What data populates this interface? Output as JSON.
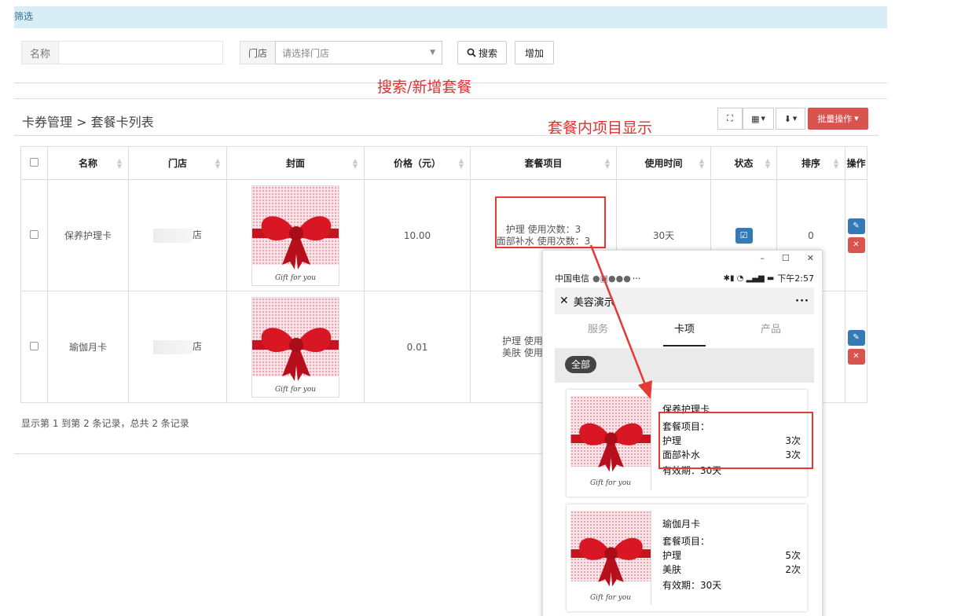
{
  "filter": {
    "title": "筛选"
  },
  "search": {
    "name_label": "名称",
    "name_value": "",
    "store_label": "门店",
    "store_placeholder": "请选择门店",
    "search_label": "搜索",
    "add_label": "增加"
  },
  "annotations": {
    "search_add": "搜索/新增套餐",
    "items_display": "套餐内项目显示"
  },
  "breadcrumb": "卡券管理 > 套餐卡列表",
  "toolbar": {
    "batch_label": "批量操作"
  },
  "table": {
    "headers": [
      "名称",
      "门店",
      "封面",
      "价格（元）",
      "套餐项目",
      "使用时间",
      "状态",
      "排序",
      "操作"
    ],
    "rows": [
      {
        "name": "保养护理卡",
        "store_suffix": "店",
        "gift_text": "Gift for you",
        "price": "10.00",
        "items": [
          "护理 使用次数：3",
          "面部补水 使用次数：3"
        ],
        "usage_time": "30天",
        "sort": "0"
      },
      {
        "name": "瑜伽月卡",
        "store_suffix": "店",
        "gift_text": "Gift for you",
        "price": "0.01",
        "items": [
          "护理 使用",
          "美肤 使用"
        ],
        "usage_time": "",
        "sort": ""
      }
    ]
  },
  "footer": {
    "info": "显示第 1 到第 2 条记录，总共 2 条记录"
  },
  "phone": {
    "carrier": "中国电信",
    "status_icons": "··· ",
    "time": "下午2:57",
    "title": "美容演示",
    "more": "···",
    "tabs": [
      "服务",
      "卡项",
      "产品"
    ],
    "active_tab": 1,
    "chip": "全部",
    "cards": [
      {
        "name": "保养护理卡",
        "items_label": "套餐项目：",
        "items": [
          {
            "name": "护理",
            "count": "3次"
          },
          {
            "name": "面部补水",
            "count": "3次"
          }
        ],
        "validity": "有效期：30天",
        "gift_text": "Gift for you"
      },
      {
        "name": "瑜伽月卡",
        "items_label": "套餐项目：",
        "items": [
          {
            "name": "护理",
            "count": "5次"
          },
          {
            "name": "美肤",
            "count": "2次"
          }
        ],
        "validity": "有效期：30天",
        "gift_text": "Gift for you"
      }
    ]
  },
  "colors": {
    "accent_blue": "#337ab7",
    "danger_red": "#d9534f",
    "annotation_red": "#e53935",
    "filter_bg": "#d9edf7"
  }
}
